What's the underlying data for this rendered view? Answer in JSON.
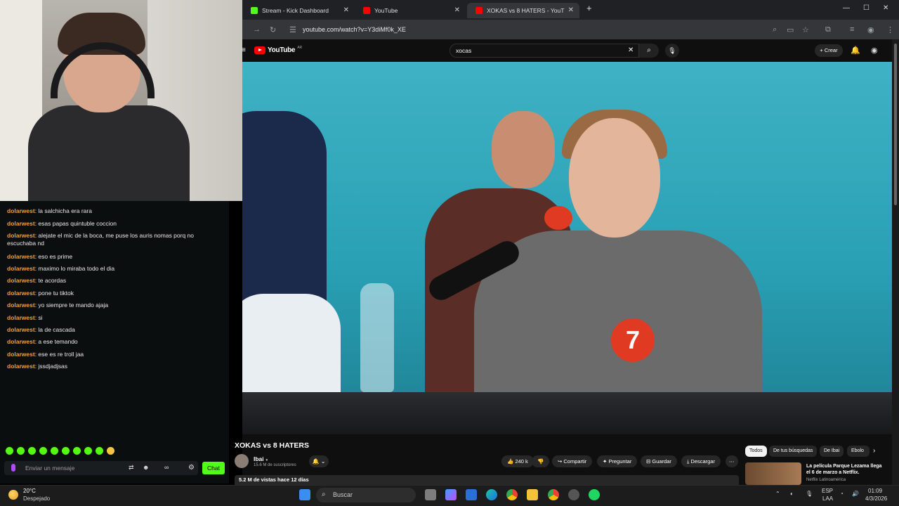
{
  "webcam": {},
  "chat": {
    "messages": [
      {
        "user": "dolarwest",
        "text": "la salchicha era rara"
      },
      {
        "user": "dolarwest",
        "text": "esas papas quintuble coccion"
      },
      {
        "user": "dolarwest",
        "text": "alejate el mic de la boca, me puse los auris nomas porq no escuchaba nd"
      },
      {
        "user": "dolarwest",
        "text": "eso es prime"
      },
      {
        "user": "dolarwest",
        "text": "maximo lo miraba todo el dia"
      },
      {
        "user": "dolarwest",
        "text": "te acordas"
      },
      {
        "user": "dolarwest",
        "text": "pone tu tiktok"
      },
      {
        "user": "dolarwest",
        "text": "yo siempre te mando ajaja"
      },
      {
        "user": "dolarwest",
        "text": "si"
      },
      {
        "user": "dolarwest",
        "text": "la de cascada"
      },
      {
        "user": "dolarwest",
        "text": "a ese temando"
      },
      {
        "user": "dolarwest",
        "text": "ese es re troll jaa"
      },
      {
        "user": "dolarwest",
        "text": "jssdjadjsas"
      }
    ],
    "input_placeholder": "Enviar un mensaje",
    "send_label": "Chat",
    "accent": "#53fc18"
  },
  "browser": {
    "tabs": [
      {
        "label": "Stream - Kick Dashboard",
        "favicon_color": "#53fc18"
      },
      {
        "label": "YouTube",
        "favicon_color": "#ff0000"
      },
      {
        "label": "XOKAS vs 8 HATERS - YouT",
        "favicon_color": "#ff0000"
      }
    ],
    "url": "youtube.com/watch?v=Y3diMf0k_XE"
  },
  "youtube": {
    "logo_text": "YouTube",
    "logo_region": "AR",
    "search_value": "xocas",
    "create_label": "Crear",
    "video_badge_number": "7",
    "video_title": "XOKAS vs 8 HATERS",
    "channel_name": "Ibai",
    "subscribers": "15.6 M de suscriptores",
    "likes": "240 k",
    "actions": [
      "Compartir",
      "Preguntar",
      "Guardar",
      "Descargar"
    ],
    "views_line": "5.2 M de vistas  hace 12 días",
    "chips": [
      "Todos",
      "De tus búsquedas",
      "De Ibai",
      "Ebolo"
    ],
    "recommended": {
      "title": "La película Parque Lezama llega el 6 de marzo a Netflix.",
      "channel": "Netflix Latinoamérica"
    }
  },
  "taskbar": {
    "weather_temp": "20°C",
    "weather_desc": "Despejado",
    "search_label": "Buscar",
    "lang": "ESP",
    "lang_sub": "LAA",
    "time": "01:09",
    "date": "4/3/2026"
  }
}
